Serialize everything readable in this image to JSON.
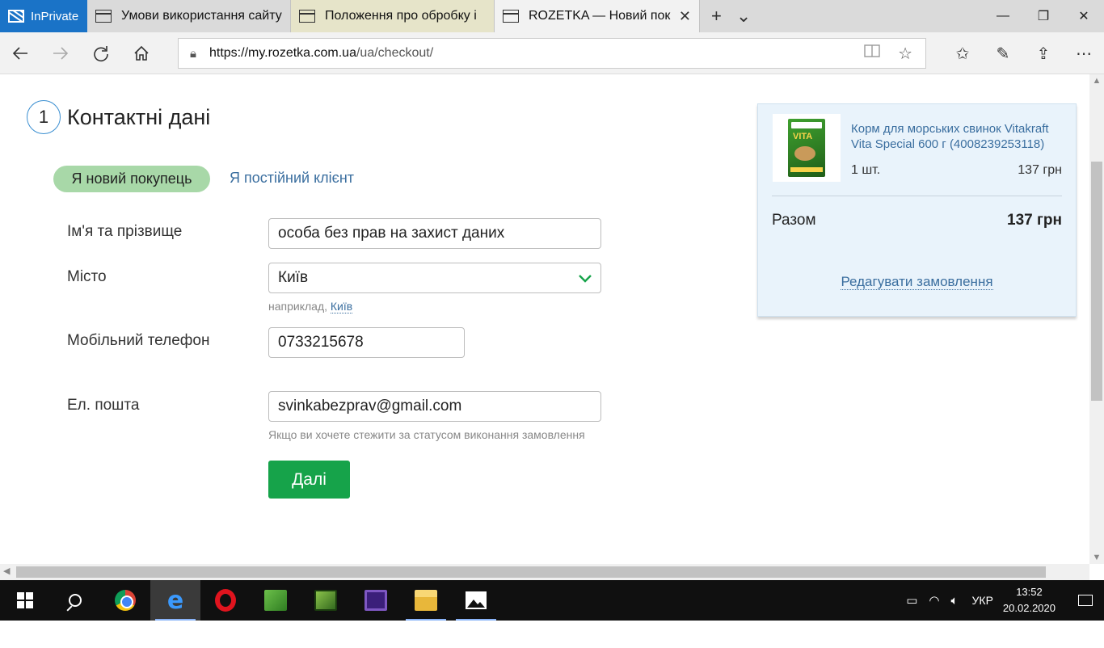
{
  "browser": {
    "inprivate_label": "InPrivate",
    "tabs": [
      {
        "title": "Умови використання сайту"
      },
      {
        "title": "Положення про обробку і"
      },
      {
        "title": "ROZETKA — Новий пок"
      }
    ],
    "new_tab_symbol": "+",
    "tab_list_symbol": "⌄",
    "window_controls": {
      "minimize": "—",
      "restore": "❐",
      "close": "✕"
    },
    "url_host": "https://my.rozetka.com.ua",
    "url_path": "/ua/checkout/"
  },
  "checkout": {
    "step_number": "1",
    "step_title": "Контактні дані",
    "tab_new_customer": "Я новий покупець",
    "tab_existing_customer": "Я постійний клієнт",
    "fields": {
      "name_label": "Ім'я та прізвище",
      "name_value": "особа без прав на захист даних",
      "city_label": "Місто",
      "city_value": "Київ",
      "city_hint_prefix": "наприклад,",
      "city_hint_link": "Київ",
      "phone_label": "Мобільний телефон",
      "phone_value": "0733215678",
      "email_label": "Ел. пошта",
      "email_value": "svinkabezprav@gmail.com",
      "email_hint": "Якщо ви хочете стежити за статусом виконання замовлення"
    },
    "next_button": "Далі"
  },
  "summary": {
    "product_name": "Корм для морських свинок Vitakraft Vita Special 600 г (4008239253118)",
    "quantity": "1 шт.",
    "price": "137 грн",
    "total_label": "Разом",
    "total_value": "137 грн",
    "edit_link": "Редагувати замовлення",
    "product_box_text": "VITA"
  },
  "taskbar": {
    "language": "УКР",
    "time": "13:52",
    "date": "20.02.2020"
  },
  "colors": {
    "accent_blue": "#1a73c7",
    "link_blue": "#3a6e9f",
    "green_button": "#16a34a",
    "pill_green": "#a8d8a8",
    "summary_bg": "#e9f3fb"
  }
}
